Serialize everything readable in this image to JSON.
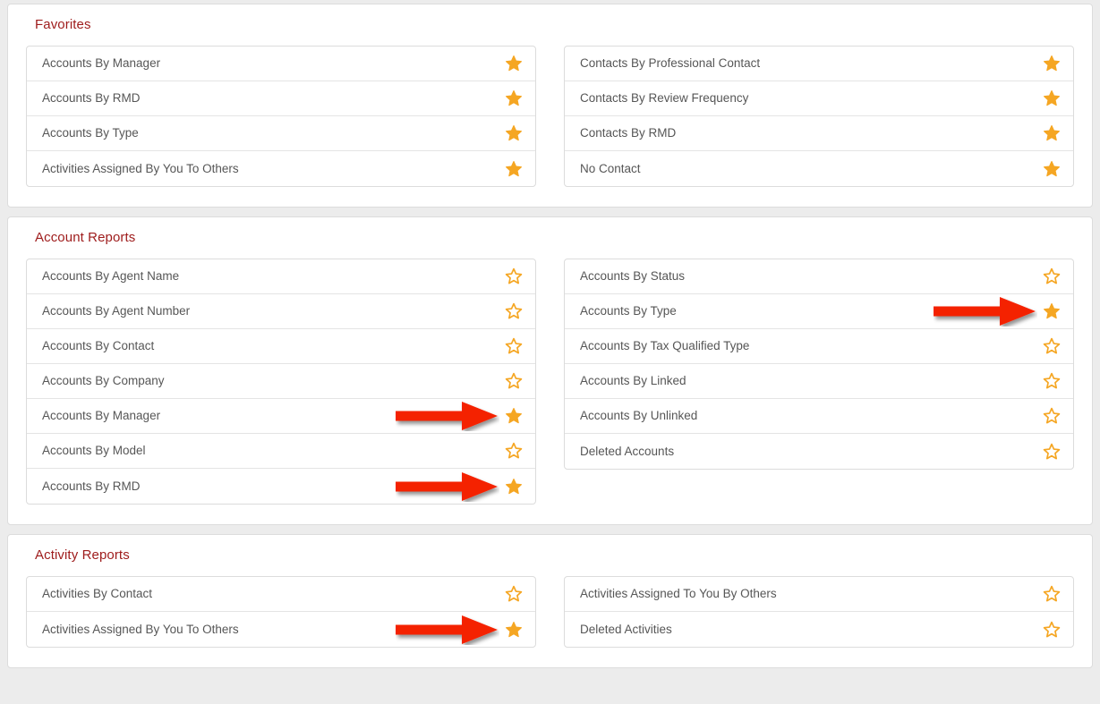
{
  "colors": {
    "page_background": "#ececec",
    "panel_background": "#ffffff",
    "panel_border": "#dcdcdc",
    "section_title": "#9e1b1b",
    "row_text": "#565656",
    "row_divider": "#e4e4e4",
    "star_filled": "#f5a623",
    "star_outline": "#f5a623",
    "annotation_arrow": "#f42100"
  },
  "sections": [
    {
      "title": "Favorites",
      "columns": [
        {
          "items": [
            {
              "label": "Accounts By Manager",
              "starred": true,
              "arrow": false,
              "icon": "star-filled-icon"
            },
            {
              "label": "Accounts By RMD",
              "starred": true,
              "arrow": false,
              "icon": "star-filled-icon"
            },
            {
              "label": "Accounts By Type",
              "starred": true,
              "arrow": false,
              "icon": "star-filled-icon"
            },
            {
              "label": "Activities Assigned By You To Others",
              "starred": true,
              "arrow": false,
              "icon": "star-filled-icon"
            }
          ]
        },
        {
          "items": [
            {
              "label": "Contacts By Professional Contact",
              "starred": true,
              "arrow": false,
              "icon": "star-filled-icon"
            },
            {
              "label": "Contacts By Review Frequency",
              "starred": true,
              "arrow": false,
              "icon": "star-filled-icon"
            },
            {
              "label": "Contacts By RMD",
              "starred": true,
              "arrow": false,
              "icon": "star-filled-icon"
            },
            {
              "label": "No Contact",
              "starred": true,
              "arrow": false,
              "icon": "star-filled-icon"
            }
          ]
        }
      ]
    },
    {
      "title": "Account Reports",
      "columns": [
        {
          "items": [
            {
              "label": "Accounts By Agent Name",
              "starred": false,
              "arrow": false,
              "icon": "star-outline-icon"
            },
            {
              "label": "Accounts By Agent Number",
              "starred": false,
              "arrow": false,
              "icon": "star-outline-icon"
            },
            {
              "label": "Accounts By Contact",
              "starred": false,
              "arrow": false,
              "icon": "star-outline-icon"
            },
            {
              "label": "Accounts By Company",
              "starred": false,
              "arrow": false,
              "icon": "star-outline-icon"
            },
            {
              "label": "Accounts By Manager",
              "starred": true,
              "arrow": true,
              "icon": "star-filled-icon"
            },
            {
              "label": "Accounts By Model",
              "starred": false,
              "arrow": false,
              "icon": "star-outline-icon"
            },
            {
              "label": "Accounts By RMD",
              "starred": true,
              "arrow": true,
              "icon": "star-filled-icon"
            }
          ]
        },
        {
          "items": [
            {
              "label": "Accounts By Status",
              "starred": false,
              "arrow": false,
              "icon": "star-outline-icon"
            },
            {
              "label": "Accounts By Type",
              "starred": true,
              "arrow": true,
              "icon": "star-filled-icon"
            },
            {
              "label": "Accounts By Tax Qualified Type",
              "starred": false,
              "arrow": false,
              "icon": "star-outline-icon"
            },
            {
              "label": "Accounts By Linked",
              "starred": false,
              "arrow": false,
              "icon": "star-outline-icon"
            },
            {
              "label": "Accounts By Unlinked",
              "starred": false,
              "arrow": false,
              "icon": "star-outline-icon"
            },
            {
              "label": "Deleted Accounts",
              "starred": false,
              "arrow": false,
              "icon": "star-outline-icon"
            }
          ]
        }
      ]
    },
    {
      "title": "Activity Reports",
      "columns": [
        {
          "items": [
            {
              "label": "Activities By Contact",
              "starred": false,
              "arrow": false,
              "icon": "star-outline-icon"
            },
            {
              "label": "Activities Assigned By You To Others",
              "starred": true,
              "arrow": true,
              "icon": "star-filled-icon"
            }
          ]
        },
        {
          "items": [
            {
              "label": "Activities Assigned To You By Others",
              "starred": false,
              "arrow": false,
              "icon": "star-outline-icon"
            },
            {
              "label": "Deleted Activities",
              "starred": false,
              "arrow": false,
              "icon": "star-outline-icon"
            }
          ]
        }
      ]
    }
  ]
}
